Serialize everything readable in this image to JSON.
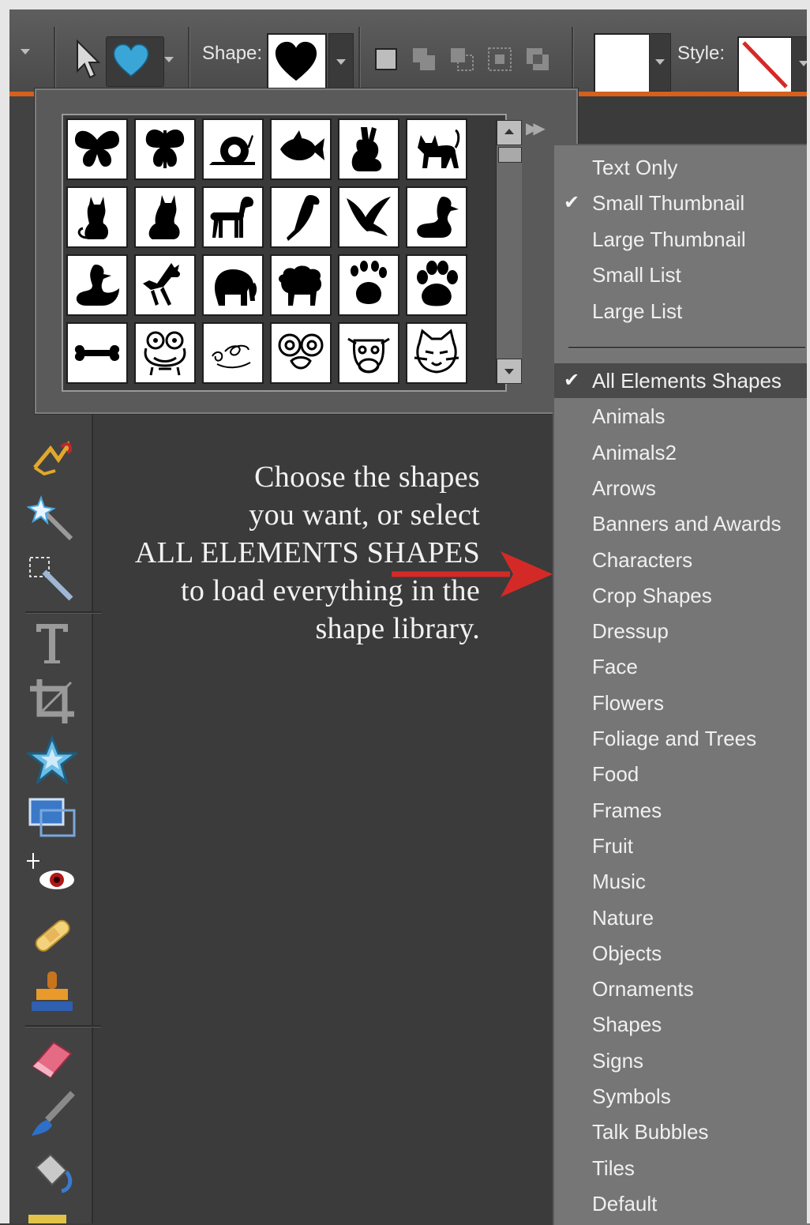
{
  "toolbar": {
    "shape_label": "Shape:",
    "style_label": "Style:",
    "icons": [
      "move-tool-icon",
      "custom-shape-heart-icon",
      "shape-mode-icons"
    ]
  },
  "picker": {
    "shapes": [
      "butterfly",
      "butterfly-2",
      "snail",
      "fish",
      "rabbit",
      "cat-standing",
      "cat-sitting",
      "cat-sitting-2",
      "dog",
      "parrot",
      "bird-flying",
      "duck",
      "duck-2",
      "deer",
      "elephant",
      "sheep",
      "paw-prints",
      "paw-print",
      "bone",
      "frog-face",
      "squiggle",
      "glasses-face",
      "cow-face",
      "cat-face"
    ]
  },
  "menu": {
    "view_items": [
      {
        "label": "Text Only",
        "checked": false
      },
      {
        "label": "Small Thumbnail",
        "checked": true
      },
      {
        "label": "Large Thumbnail",
        "checked": false
      },
      {
        "label": "Small List",
        "checked": false
      },
      {
        "label": "Large List",
        "checked": false
      }
    ],
    "libraries": [
      {
        "label": "All Elements Shapes",
        "checked": true
      },
      {
        "label": "Animals",
        "checked": false
      },
      {
        "label": "Animals2",
        "checked": false
      },
      {
        "label": "Arrows",
        "checked": false
      },
      {
        "label": "Banners and Awards",
        "checked": false
      },
      {
        "label": "Characters",
        "checked": false
      },
      {
        "label": "Crop Shapes",
        "checked": false
      },
      {
        "label": "Dressup",
        "checked": false
      },
      {
        "label": "Face",
        "checked": false
      },
      {
        "label": "Flowers",
        "checked": false
      },
      {
        "label": "Foliage and Trees",
        "checked": false
      },
      {
        "label": "Food",
        "checked": false
      },
      {
        "label": "Frames",
        "checked": false
      },
      {
        "label": "Fruit",
        "checked": false
      },
      {
        "label": "Music",
        "checked": false
      },
      {
        "label": "Nature",
        "checked": false
      },
      {
        "label": "Objects",
        "checked": false
      },
      {
        "label": "Ornaments",
        "checked": false
      },
      {
        "label": "Shapes",
        "checked": false
      },
      {
        "label": "Signs",
        "checked": false
      },
      {
        "label": "Symbols",
        "checked": false
      },
      {
        "label": "Talk Bubbles",
        "checked": false
      },
      {
        "label": "Tiles",
        "checked": false
      },
      {
        "label": "Default",
        "checked": false
      }
    ],
    "check_glyph": "✔"
  },
  "annotation": {
    "lines": [
      "Choose the shapes",
      "you want, or select",
      "ALL ELEMENTS SHAPES",
      "to load everything in the",
      "shape library."
    ],
    "arrow_color": "#d42a27"
  },
  "colors": {
    "accent_bar": "#d5611c",
    "heart_blue": "#3aa6d8"
  }
}
